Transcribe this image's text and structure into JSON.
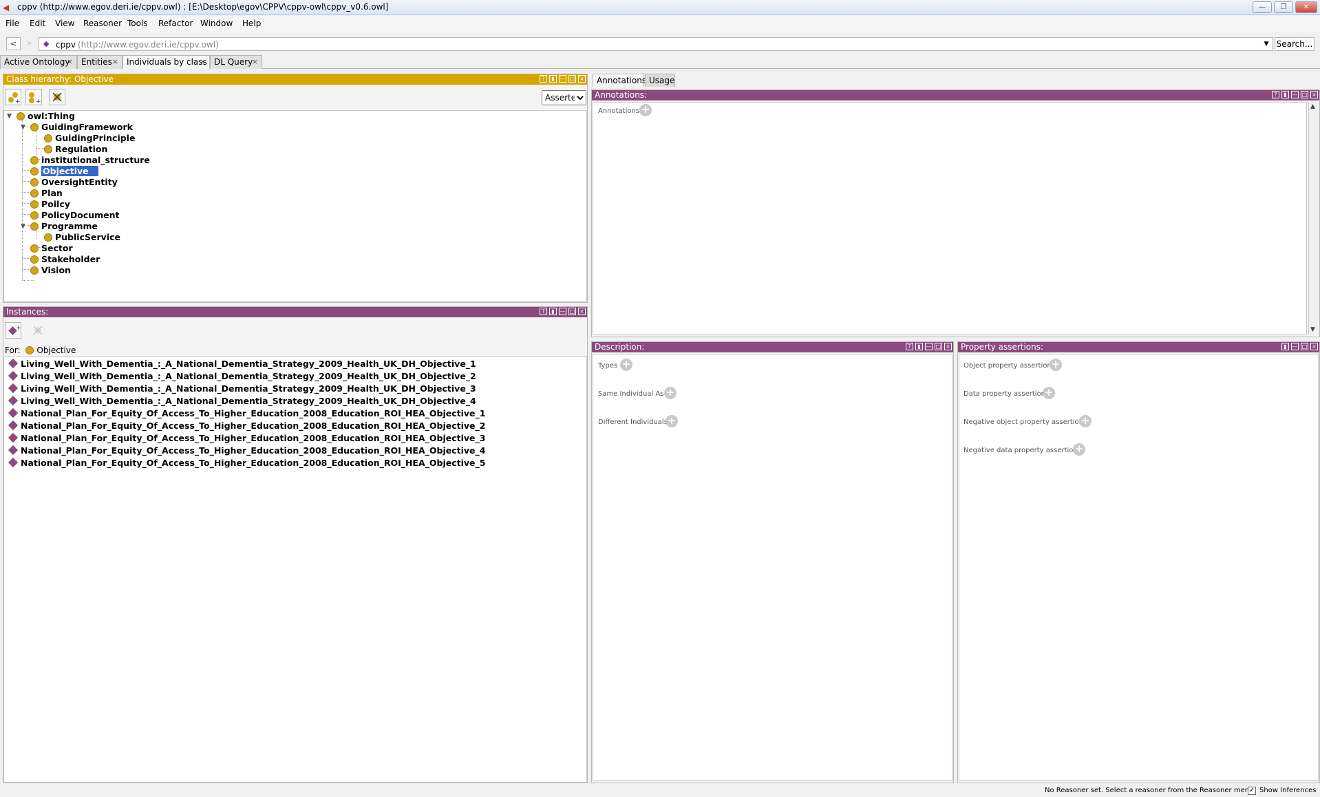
{
  "window": {
    "title": "cppv (http://www.egov.deri.ie/cppv.owl)  : [E:\\Desktop\\egov\\CPPV\\cppv-owl\\cppv_v0.6.owl]",
    "buttons": [
      "minimize-button",
      "restore-button",
      "close-button"
    ]
  },
  "menu": {
    "items": [
      "File",
      "Edit",
      "View",
      "Reasoner",
      "Tools",
      "Refactor",
      "Window",
      "Help"
    ]
  },
  "address": {
    "back": "<",
    "forward": ">",
    "ontology_name": "cppv",
    "ontology_uri": "(http://www.egov.deri.ie/cppv.owl)",
    "search_label": "Search..."
  },
  "tabs": [
    {
      "label": "Active Ontology"
    },
    {
      "label": "Entities"
    },
    {
      "label": "Individuals by class"
    },
    {
      "label": "DL Query"
    }
  ],
  "class_hierarchy": {
    "title": "Class hierarchy: Objective",
    "mode": "Asserted",
    "nodes": [
      {
        "label": "owl:Thing"
      },
      {
        "label": "GuidingFramework"
      },
      {
        "label": "GuidingPrinciple"
      },
      {
        "label": "Regulation"
      },
      {
        "label": "institutional_structure"
      },
      {
        "label": "Objective",
        "selected": true
      },
      {
        "label": "OversightEntity"
      },
      {
        "label": "Plan"
      },
      {
        "label": "Poilcy"
      },
      {
        "label": "PolicyDocument"
      },
      {
        "label": "Programme"
      },
      {
        "label": "PublicService"
      },
      {
        "label": "Sector"
      },
      {
        "label": "Stakeholder"
      },
      {
        "label": "Vision"
      }
    ]
  },
  "instances": {
    "title": "Instances:",
    "for_label": "For:",
    "for_class": "Objective",
    "items": [
      "Living_Well_With_Dementia_:_A_National_Dementia_Strategy_2009_Health_UK_DH_Objective_1",
      "Living_Well_With_Dementia_:_A_National_Dementia_Strategy_2009_Health_UK_DH_Objective_2",
      "Living_Well_With_Dementia_:_A_National_Dementia_Strategy_2009_Health_UK_DH_Objective_3",
      "Living_Well_With_Dementia_:_A_National_Dementia_Strategy_2009_Health_UK_DH_Objective_4",
      "National_Plan_For_Equity_Of_Access_To_Higher_Education_2008_Education_ROI_HEA_Objective_1",
      "National_Plan_For_Equity_Of_Access_To_Higher_Education_2008_Education_ROI_HEA_Objective_2",
      "National_Plan_For_Equity_Of_Access_To_Higher_Education_2008_Education_ROI_HEA_Objective_3",
      "National_Plan_For_Equity_Of_Access_To_Higher_Education_2008_Education_ROI_HEA_Objective_4",
      "National_Plan_For_Equity_Of_Access_To_Higher_Education_2008_Education_ROI_HEA_Objective_5"
    ]
  },
  "right_tabs": [
    "Annotations",
    "Usage"
  ],
  "annotations": {
    "title": "Annotations:",
    "section": "Annotations"
  },
  "description": {
    "title": "Description:",
    "sections": [
      "Types",
      "Same Individual As",
      "Different Individuals"
    ]
  },
  "property_assertions": {
    "title": "Property assertions:",
    "sections": [
      "Object property assertions",
      "Data property assertions",
      "Negative object property assertions",
      "Negative data property assertions"
    ]
  },
  "status": {
    "message": "No Reasoner set. Select a reasoner from the Reasoner menu",
    "show_inferences": "Show Inferences",
    "show_inferences_checked": true
  },
  "colors": {
    "class_header": "#d6a500",
    "view_header": "#8b4a7f",
    "class_icon": "#d4a517",
    "individual_icon": "#8b4a7f",
    "selection": "#3368c8"
  }
}
